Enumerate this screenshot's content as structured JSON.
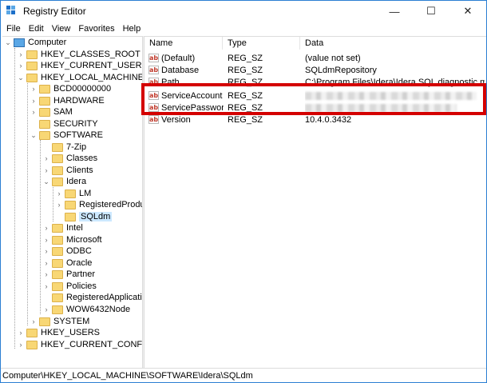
{
  "window": {
    "title": "Registry Editor",
    "controls": {
      "minimize": "—",
      "maximize": "☐",
      "close": "✕"
    }
  },
  "menu": [
    "File",
    "Edit",
    "View",
    "Favorites",
    "Help"
  ],
  "tree": [
    {
      "label": "Computer",
      "expanded": true
    },
    {
      "label": "HKEY_CLASSES_ROOT"
    },
    {
      "label": "HKEY_CURRENT_USER"
    },
    {
      "label": "HKEY_LOCAL_MACHINE",
      "expanded": true
    },
    {
      "label": "BCD00000000"
    },
    {
      "label": "HARDWARE"
    },
    {
      "label": "SAM"
    },
    {
      "label": "SECURITY"
    },
    {
      "label": "SOFTWARE",
      "expanded": true
    },
    {
      "label": "7-Zip"
    },
    {
      "label": "Classes"
    },
    {
      "label": "Clients"
    },
    {
      "label": "Idera",
      "expanded": true
    },
    {
      "label": "LM"
    },
    {
      "label": "RegisteredProduc"
    },
    {
      "label": "SQLdm",
      "selected": true
    },
    {
      "label": "Intel"
    },
    {
      "label": "Microsoft"
    },
    {
      "label": "ODBC"
    },
    {
      "label": "Oracle"
    },
    {
      "label": "Partner"
    },
    {
      "label": "Policies"
    },
    {
      "label": "RegisteredApplication"
    },
    {
      "label": "WOW6432Node"
    },
    {
      "label": "SYSTEM"
    },
    {
      "label": "HKEY_USERS"
    },
    {
      "label": "HKEY_CURRENT_CONFIG"
    }
  ],
  "list": {
    "columns": [
      "Name",
      "Type",
      "Data"
    ],
    "rows": [
      {
        "name": "(Default)",
        "type": "REG_SZ",
        "data": "(value not set)"
      },
      {
        "name": "Database",
        "type": "REG_SZ",
        "data": "SQLdmRepository"
      },
      {
        "name": "Path",
        "type": "REG_SZ",
        "data": "C:\\Program Files\\Idera\\Idera SQL diagnostic mana"
      },
      {
        "name": "ServiceAccount",
        "type": "REG_SZ",
        "data": "",
        "obscured": true
      },
      {
        "name": "ServicePassword",
        "type": "REG_SZ",
        "data": "",
        "obscured": true
      },
      {
        "name": "Version",
        "type": "REG_SZ",
        "data": "10.4.0.3432"
      }
    ]
  },
  "status": "Computer\\HKEY_LOCAL_MACHINE\\SOFTWARE\\Idera\\SQLdm",
  "colors": {
    "highlight": "#d40000",
    "selection": "#cce8ff",
    "folder": "#f8d775"
  }
}
